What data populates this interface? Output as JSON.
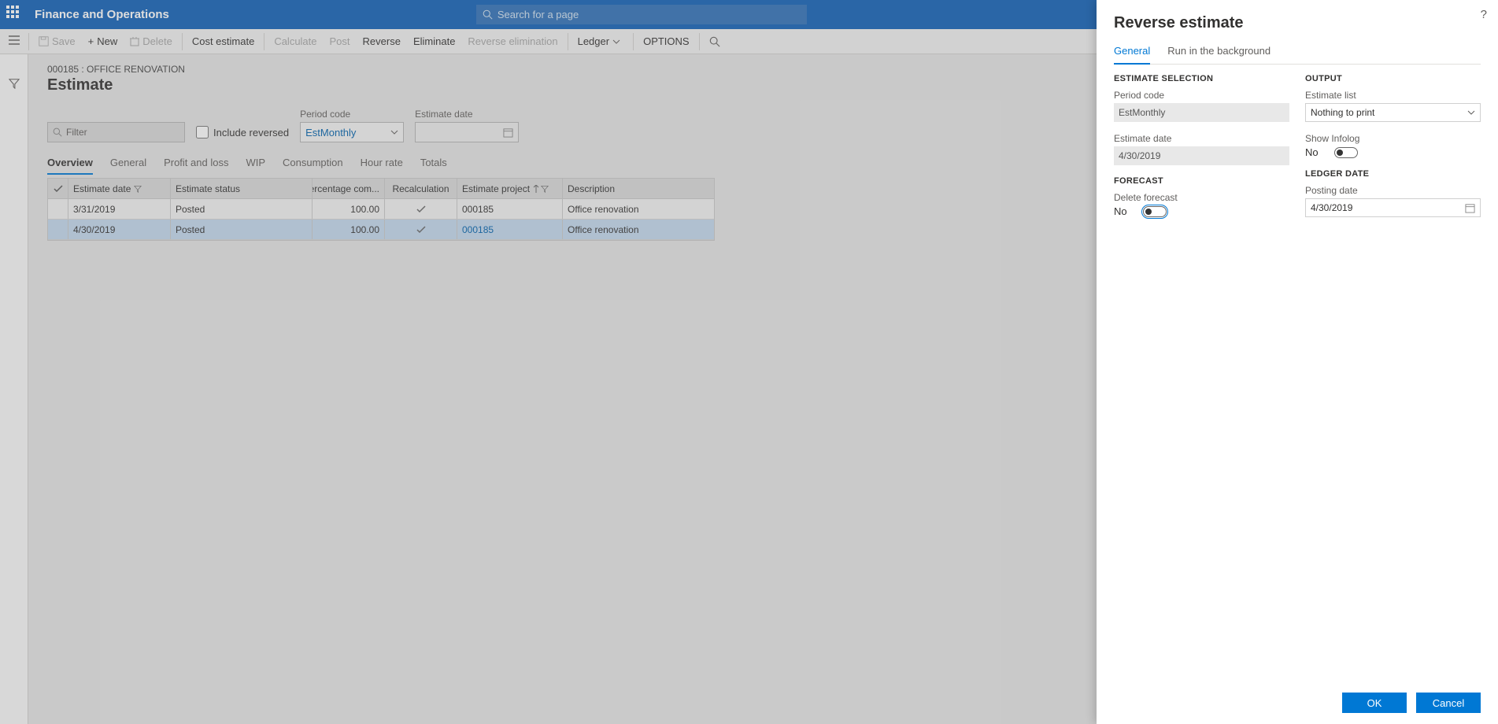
{
  "app": {
    "title": "Finance and Operations",
    "search_placeholder": "Search for a page"
  },
  "actions": {
    "save": "Save",
    "new": "New",
    "delete": "Delete",
    "cost_estimate": "Cost estimate",
    "calculate": "Calculate",
    "post": "Post",
    "reverse": "Reverse",
    "eliminate": "Eliminate",
    "reverse_elimination": "Reverse elimination",
    "ledger": "Ledger",
    "options": "OPTIONS"
  },
  "page": {
    "breadcrumb": "000185 : OFFICE RENOVATION",
    "title": "Estimate"
  },
  "filters": {
    "filter_placeholder": "Filter",
    "include_reversed": "Include reversed",
    "period_code_label": "Period code",
    "period_code_value": "EstMonthly",
    "estimate_date_label": "Estimate date",
    "estimate_date_value": ""
  },
  "tabs": [
    "Overview",
    "General",
    "Profit and loss",
    "WIP",
    "Consumption",
    "Hour rate",
    "Totals"
  ],
  "grid": {
    "columns": {
      "estimate_date": "Estimate date",
      "estimate_status": "Estimate status",
      "pct": "Percentage com...",
      "recalc": "Recalculation",
      "project": "Estimate project",
      "desc": "Description"
    },
    "rows": [
      {
        "date": "3/31/2019",
        "status": "Posted",
        "pct": "100.00",
        "recalc": true,
        "project": "000185",
        "desc": "Office renovation",
        "selected": false
      },
      {
        "date": "4/30/2019",
        "status": "Posted",
        "pct": "100.00",
        "recalc": true,
        "project": "000185",
        "desc": "Office renovation",
        "selected": true
      }
    ]
  },
  "panel": {
    "title": "Reverse estimate",
    "tabs": {
      "general": "General",
      "background": "Run in the background"
    },
    "sections": {
      "estimate_selection": "ESTIMATE SELECTION",
      "output": "OUTPUT",
      "forecast": "FORECAST",
      "ledger_date": "LEDGER DATE"
    },
    "fields": {
      "period_code_label": "Period code",
      "period_code_value": "EstMonthly",
      "estimate_date_label": "Estimate date",
      "estimate_date_value": "4/30/2019",
      "estimate_list_label": "Estimate list",
      "estimate_list_value": "Nothing to print",
      "show_infolog_label": "Show Infolog",
      "show_infolog_value": "No",
      "delete_forecast_label": "Delete forecast",
      "delete_forecast_value": "No",
      "posting_date_label": "Posting date",
      "posting_date_value": "4/30/2019"
    },
    "buttons": {
      "ok": "OK",
      "cancel": "Cancel"
    }
  }
}
